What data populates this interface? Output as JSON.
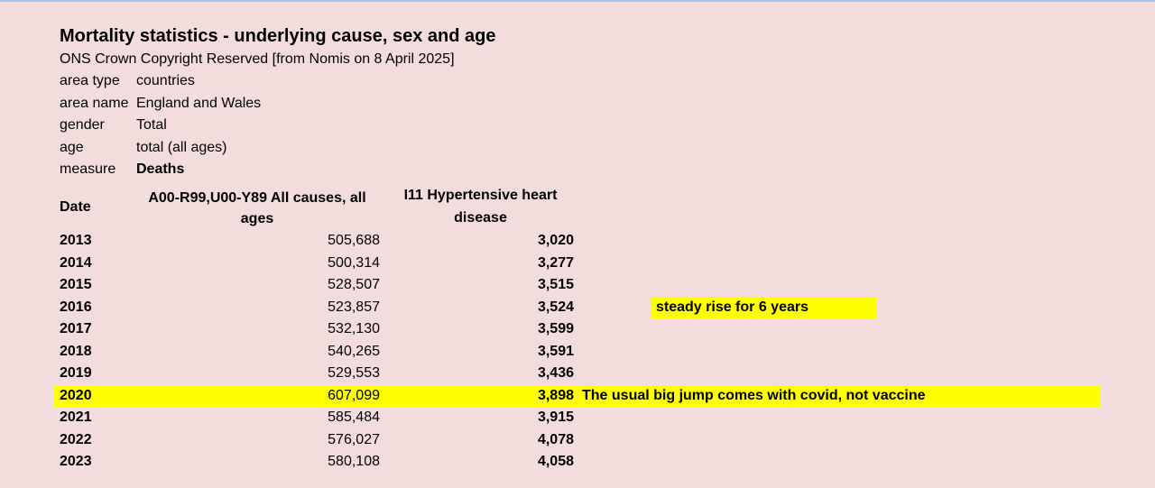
{
  "title": "Mortality statistics - underlying cause, sex and age",
  "source": "ONS Crown Copyright Reserved [from Nomis on 8 April 2025]",
  "meta": [
    {
      "key": "area type",
      "value": "countries"
    },
    {
      "key": "area name",
      "value": "England and Wales"
    },
    {
      "key": "gender",
      "value": "Total"
    },
    {
      "key": "age",
      "value": "total (all ages)"
    },
    {
      "key": "measure",
      "value": "Deaths"
    }
  ],
  "columns": {
    "date": "Date",
    "all_causes": "A00-R99,U00-Y89 All causes, all ages",
    "hypertensive": "I11 Hypertensive heart disease"
  },
  "rows": [
    {
      "date": "2013",
      "all": "505,688",
      "hyp": "3,020"
    },
    {
      "date": "2014",
      "all": "500,314",
      "hyp": "3,277"
    },
    {
      "date": "2015",
      "all": "528,507",
      "hyp": "3,515"
    },
    {
      "date": "2016",
      "all": "523,857",
      "hyp": "3,524"
    },
    {
      "date": "2017",
      "all": "532,130",
      "hyp": "3,599"
    },
    {
      "date": "2018",
      "all": "540,265",
      "hyp": "3,591"
    },
    {
      "date": "2019",
      "all": "529,553",
      "hyp": "3,436"
    },
    {
      "date": "2020",
      "all": "607,099",
      "hyp": "3,898"
    },
    {
      "date": "2021",
      "all": "585,484",
      "hyp": "3,915"
    },
    {
      "date": "2022",
      "all": "576,027",
      "hyp": "4,078"
    },
    {
      "date": "2023",
      "all": "580,108",
      "hyp": "4,058"
    }
  ],
  "annotations": {
    "steady_rise": "steady rise for 6 years",
    "covid_jump": "The usual big jump comes with covid, not vaccine"
  },
  "colors": {
    "background": "#f3dcdc",
    "highlight": "#ffff00"
  }
}
